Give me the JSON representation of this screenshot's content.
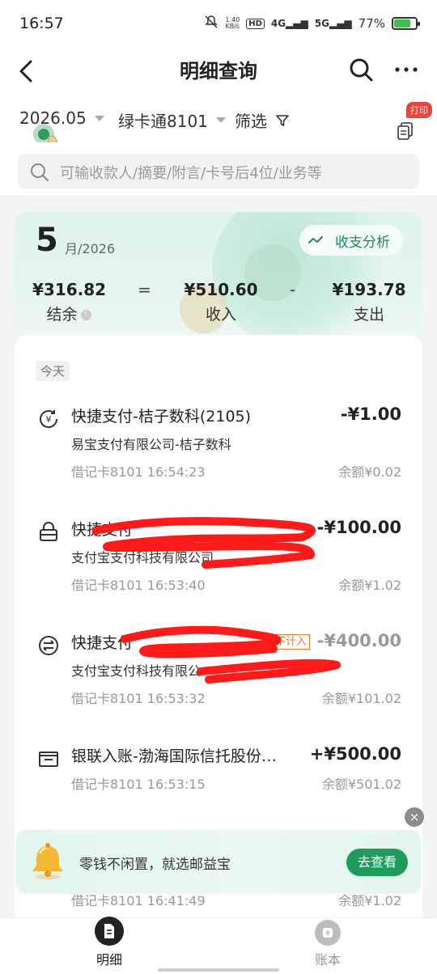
{
  "status_bar": {
    "time": "16:57",
    "net_speed_top": "1.40",
    "net_speed_unit": "KB/s",
    "hd_label": "HD",
    "sig1": "4G",
    "sig2": "5G",
    "battery": "77%",
    "battery_level": 0.77
  },
  "header": {
    "title": "明细查询"
  },
  "filters": {
    "month": "2026.05",
    "card": "绿卡通8101",
    "filter_label": "筛选",
    "print_label": "打印"
  },
  "search": {
    "placeholder": "可输收款人/摘要/附言/卡号后4位/业务等"
  },
  "summary": {
    "month_num": "5",
    "year_suffix": "月/2026",
    "analysis_label": "收支分析",
    "balance_amount": "¥316.82",
    "balance_label": "结余",
    "equals": "=",
    "income_amount": "¥510.60",
    "income_label": "收入",
    "minus": "-",
    "expense_amount": "¥193.78",
    "expense_label": "支出"
  },
  "list": {
    "section_label": "今天",
    "transactions": [
      {
        "title": "快捷支付-桔子数科(2105)",
        "subtitle": "易宝支付有限公司-桔子数科",
        "meta": "借记卡8101 16:54:23",
        "amount": "-¥1.00",
        "balance": "余额¥0.02",
        "icon": "yuan-refresh-icon"
      },
      {
        "title": "快捷支付",
        "subtitle": "支付宝支付科技有限公司",
        "meta": "借记卡8101 16:53:40",
        "amount": "-¥100.00",
        "balance": "余额¥1.02",
        "icon": "shopping-basket-icon"
      },
      {
        "title": "快捷支付",
        "subtitle": "支付宝支付科技有限公",
        "meta": "借记卡8101 16:53:32",
        "amount": "-¥400.00",
        "balance": "余额¥101.02",
        "tag": "不计入",
        "icon": "transfer-icon"
      },
      {
        "title": "银联入账-渤海国际信托股份…",
        "meta": "借记卡8101 16:53:15",
        "amount": "+¥500.00",
        "balance": "余额¥501.02",
        "icon": "bank-card-icon"
      }
    ],
    "peek_meta": "借记卡8101 16:41:49",
    "peek_balance": "余额¥1.02"
  },
  "banner": {
    "text": "零钱不闲置，就选邮益宝",
    "button": "去查看",
    "close": "×"
  },
  "nav": {
    "items": [
      {
        "label": "明细",
        "active": true
      },
      {
        "label": "账本",
        "active": false
      }
    ]
  },
  "colors": {
    "accent_green": "#1d9c5e",
    "tag_orange": "#e8822a",
    "badge_red": "#e8463c"
  }
}
